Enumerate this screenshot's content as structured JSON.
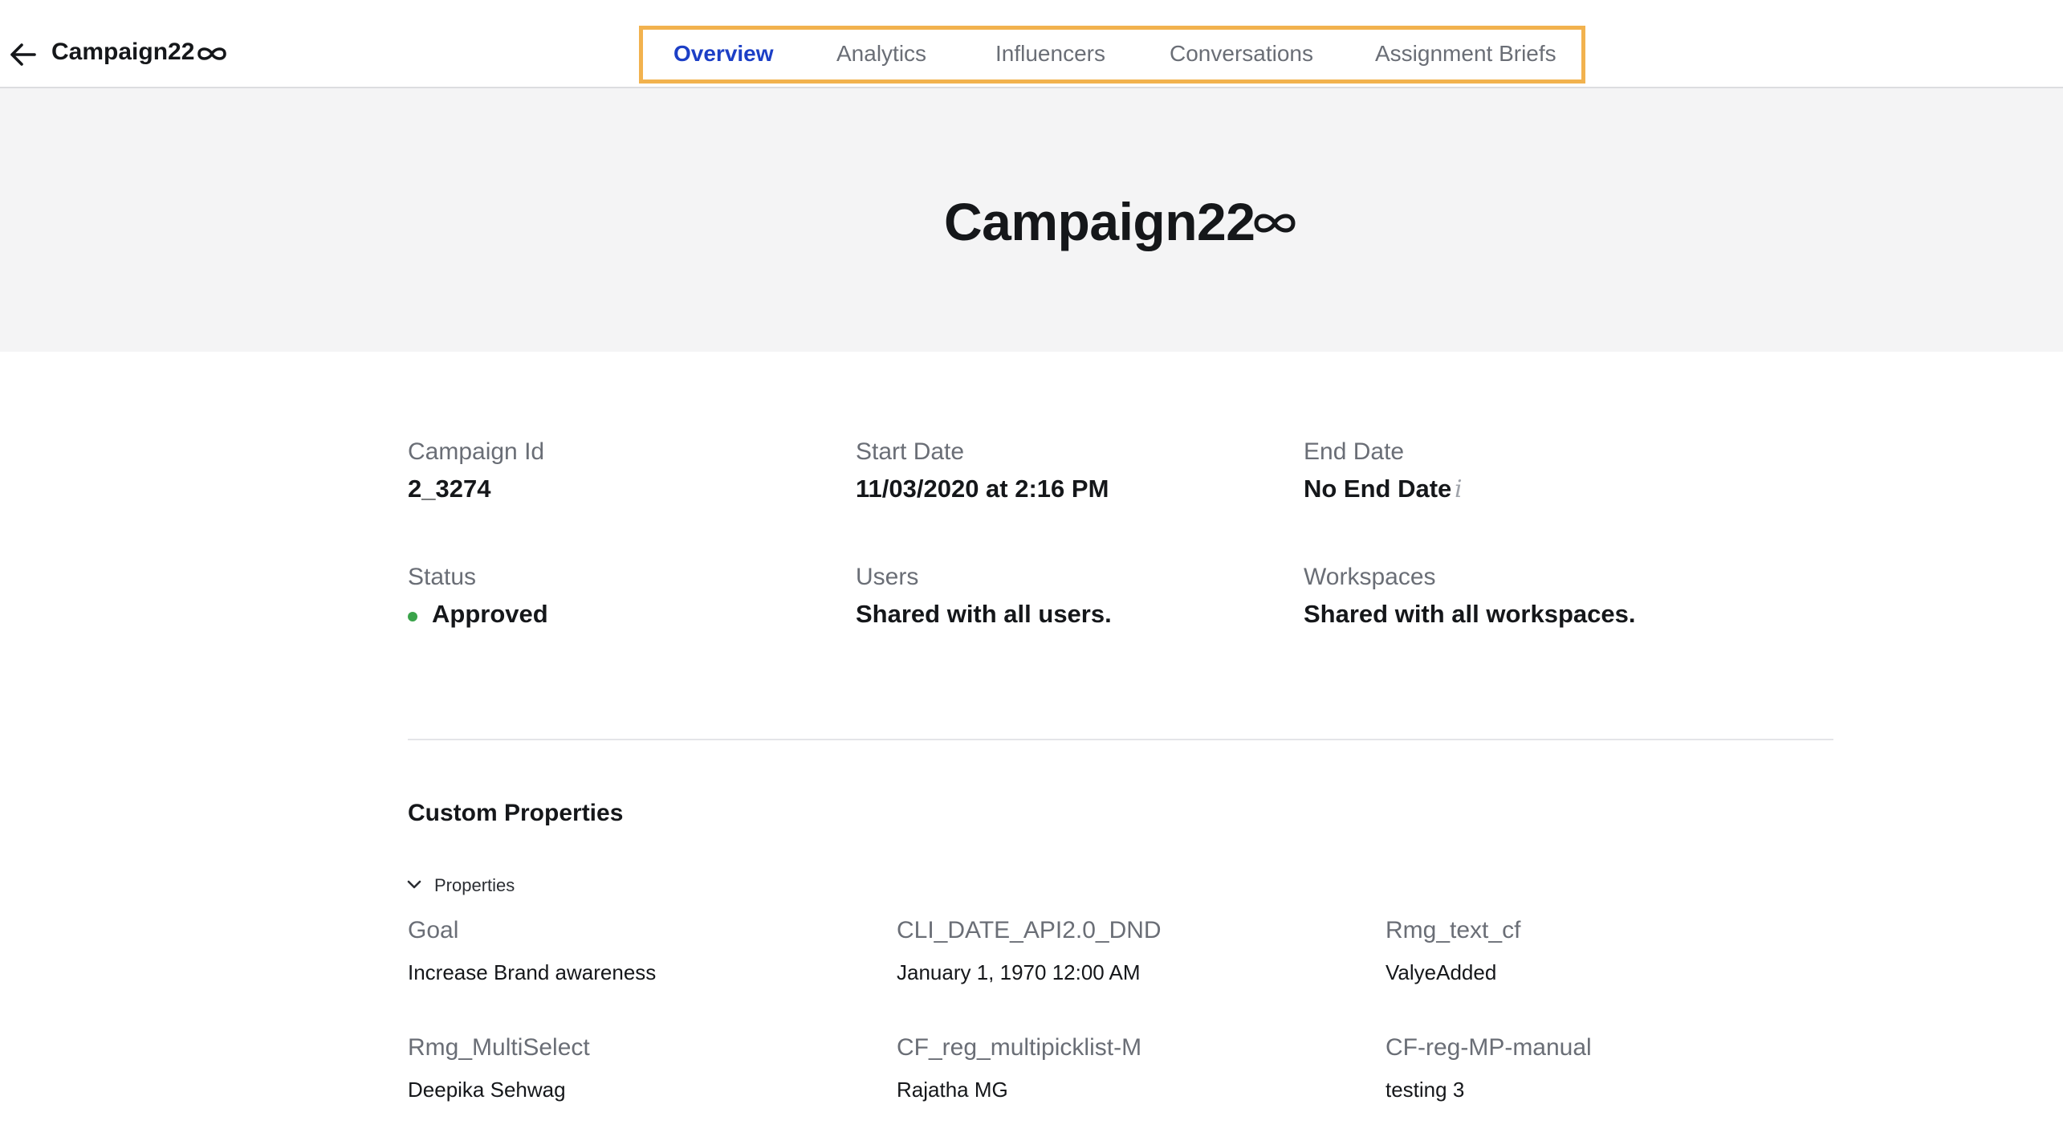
{
  "header": {
    "back_label": "Back",
    "title": "Campaign22",
    "tabs": [
      {
        "label": "Overview",
        "active": true
      },
      {
        "label": "Analytics",
        "active": false
      },
      {
        "label": "Influencers",
        "active": false
      },
      {
        "label": "Conversations",
        "active": false
      },
      {
        "label": "Assignment Briefs",
        "active": false
      }
    ]
  },
  "hero": {
    "title": "Campaign22"
  },
  "details": {
    "campaign_id": {
      "label": "Campaign Id",
      "value": "2_3274"
    },
    "start_date": {
      "label": "Start Date",
      "value": "11/03/2020 at 2:16 PM"
    },
    "end_date": {
      "label": "End Date",
      "value": "No End Date"
    },
    "status": {
      "label": "Status",
      "value": "Approved"
    },
    "users": {
      "label": "Users",
      "value": "Shared with all users."
    },
    "workspaces": {
      "label": "Workspaces",
      "value": "Shared with all workspaces."
    }
  },
  "custom_properties": {
    "title": "Custom Properties",
    "group_label": "Properties",
    "items": [
      {
        "label": "Goal",
        "value": "Increase Brand awareness"
      },
      {
        "label": "CLI_DATE_API2.0_DND",
        "value": "January 1, 1970 12:00 AM"
      },
      {
        "label": "Rmg_text_cf",
        "value": "ValyeAdded"
      },
      {
        "label": "Rmg_MultiSelect",
        "value": "Deepika Sehwag"
      },
      {
        "label": "CF_reg_multipicklist-M",
        "value": "Rajatha MG"
      },
      {
        "label": "CF-reg-MP-manual",
        "value": "testing 3"
      }
    ]
  },
  "colors": {
    "accent": "#1c3fc6",
    "tab_highlight": "#f2b24e",
    "status_approved": "#3aa34a",
    "hero_bg": "#f4f4f5"
  },
  "icons": {
    "back": "arrow-left-icon",
    "infinity": "infinity-icon",
    "info": "info-icon",
    "chevron": "chevron-down-icon"
  }
}
